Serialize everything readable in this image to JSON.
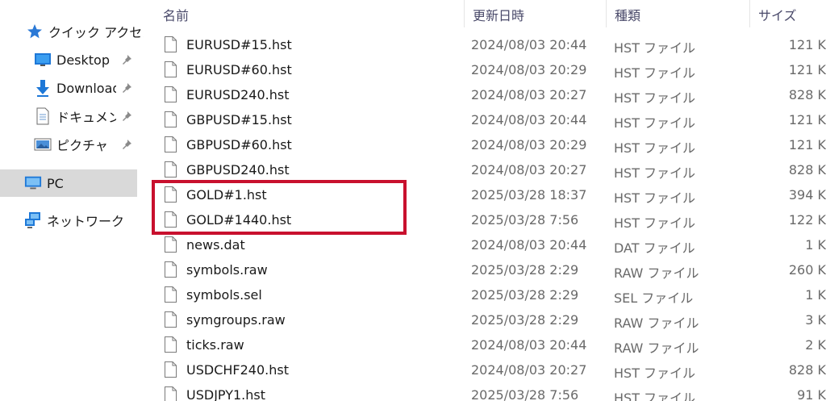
{
  "nav": {
    "quick_access": "クイック アクセス",
    "desktop": "Desktop",
    "downloads": "Downloads",
    "documents": "ドキュメント",
    "pictures": "ピクチャ",
    "pc": "PC",
    "network": "ネットワーク"
  },
  "columns": {
    "name": "名前",
    "date": "更新日時",
    "type": "種類",
    "size": "サイズ"
  },
  "files": [
    {
      "name": "EURUSD#15.hst",
      "date": "2024/08/03 20:44",
      "type": "HST ファイル",
      "size": "121 K"
    },
    {
      "name": "EURUSD#60.hst",
      "date": "2024/08/03 20:29",
      "type": "HST ファイル",
      "size": "121 K"
    },
    {
      "name": "EURUSD240.hst",
      "date": "2024/08/03 20:27",
      "type": "HST ファイル",
      "size": "828 K"
    },
    {
      "name": "GBPUSD#15.hst",
      "date": "2024/08/03 20:44",
      "type": "HST ファイル",
      "size": "121 K"
    },
    {
      "name": "GBPUSD#60.hst",
      "date": "2024/08/03 20:29",
      "type": "HST ファイル",
      "size": "121 K"
    },
    {
      "name": "GBPUSD240.hst",
      "date": "2024/08/03 20:27",
      "type": "HST ファイル",
      "size": "828 K"
    },
    {
      "name": "GOLD#1.hst",
      "date": "2025/03/28 18:37",
      "type": "HST ファイル",
      "size": "394 K"
    },
    {
      "name": "GOLD#1440.hst",
      "date": "2025/03/28 7:56",
      "type": "HST ファイル",
      "size": "122 K"
    },
    {
      "name": "news.dat",
      "date": "2024/08/03 20:44",
      "type": "DAT ファイル",
      "size": "1 K"
    },
    {
      "name": "symbols.raw",
      "date": "2025/03/28 2:29",
      "type": "RAW ファイル",
      "size": "260 K"
    },
    {
      "name": "symbols.sel",
      "date": "2025/03/28 2:29",
      "type": "SEL ファイル",
      "size": "1 K"
    },
    {
      "name": "symgroups.raw",
      "date": "2025/03/28 2:29",
      "type": "RAW ファイル",
      "size": "3 K"
    },
    {
      "name": "ticks.raw",
      "date": "2024/08/03 20:44",
      "type": "RAW ファイル",
      "size": "2 K"
    },
    {
      "name": "USDCHF240.hst",
      "date": "2024/08/03 20:27",
      "type": "HST ファイル",
      "size": "828 K"
    },
    {
      "name": "USDJPY1.hst",
      "date": "2025/03/28 7:56",
      "type": "HST ファイル",
      "size": "91 K"
    }
  ],
  "colors": {
    "highlight": "#c8102e",
    "selected_nav": "#d9d9d9",
    "accent_blue": "#1e78d7"
  },
  "icons": [
    "quick-access-star-icon",
    "desktop-icon",
    "download-arrow-icon",
    "document-icon",
    "picture-icon",
    "pin-icon",
    "pc-icon",
    "network-icon",
    "file-icon"
  ]
}
